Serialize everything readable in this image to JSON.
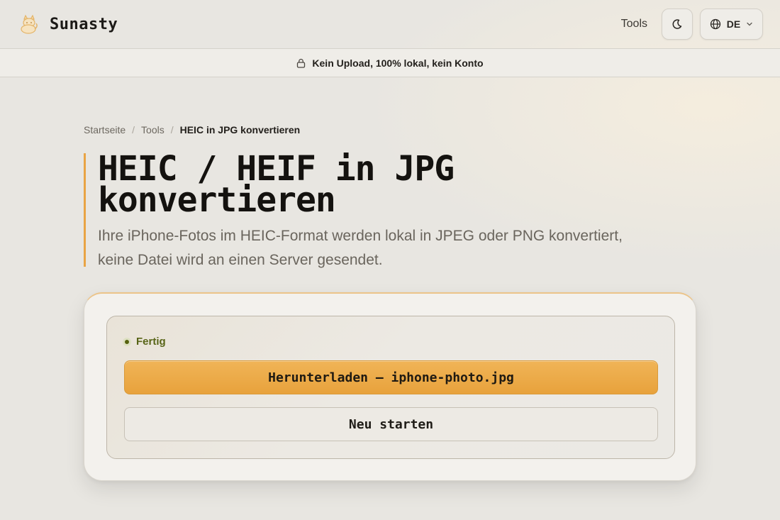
{
  "header": {
    "brand_name": "Sunasty",
    "nav_tools": "Tools",
    "theme_icon": "moon-icon",
    "lang_icon": "globe-icon",
    "lang_label": "DE"
  },
  "banner": {
    "icon": "lock-icon",
    "text": "Kein Upload, 100% lokal, kein Konto"
  },
  "breadcrumb": {
    "items": [
      "Startseite",
      "Tools"
    ],
    "current": "HEIC in JPG konvertieren",
    "separator": "/"
  },
  "main": {
    "title_line1": "HEIC / HEIF in JPG",
    "title_line2": "konvertieren",
    "subtitle_line1": "Ihre iPhone-Fotos im HEIC-Format werden lokal in JPEG oder PNG konvertiert,",
    "subtitle_line2": "keine Datei wird an einen Server gesendet."
  },
  "converter": {
    "status": "Fertig",
    "download_label": "Herunterladen — iphone-photo.jpg",
    "restart_label": "Neu starten"
  },
  "colors": {
    "accent": "#e9a445",
    "status_green": "#586417",
    "background": "#e8e6e1"
  }
}
